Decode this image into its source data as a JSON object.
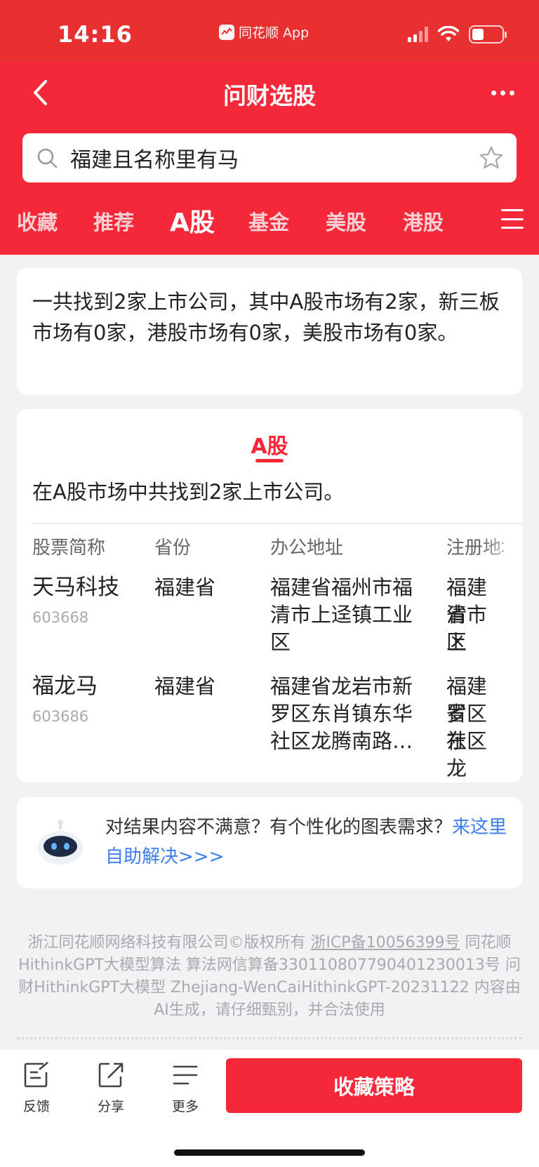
{
  "status": {
    "time": "14:16",
    "app": "同花顺 App"
  },
  "header": {
    "title": "问财选股"
  },
  "search": {
    "query": "福建且名称里有马"
  },
  "tabs": [
    "收藏",
    "推荐",
    "A股",
    "基金",
    "美股",
    "港股"
  ],
  "summary": {
    "text": "一共找到2家上市公司，其中A股市场有2家，新三板市场有0家，港股市场有0家，美股市场有0家。"
  },
  "results": {
    "market": "A股",
    "count_text": "在A股市场中共找到2家上市公司。",
    "columns": [
      "股票简称",
      "省份",
      "办公地址",
      "注册地址"
    ],
    "rows": [
      {
        "name": "天马科技",
        "code": "603668",
        "province": "福建省",
        "office": [
          "福建省福州市福",
          "清市上迳镇工业",
          "区"
        ],
        "reg": [
          "福建省",
          "清市上",
          "区"
        ]
      },
      {
        "name": "福龙马",
        "code": "603686",
        "province": "福建省",
        "office": [
          "福建省龙岩市新",
          "罗区东肖镇东华",
          "社区龙腾南路…"
        ],
        "reg": [
          "福建省",
          "罗区东",
          "社区龙"
        ]
      }
    ]
  },
  "help": {
    "text": "对结果内容不满意？有个性化的图表需求？",
    "link": "来这里自助解决>>>"
  },
  "footer": {
    "line1_a": "浙江同花顺网络科技有限公司©版权所有 ",
    "icp": "浙ICP备10056399号",
    "line1_b": " 同花顺HithinkGPT大模型算法 算法网信算备330110807790401230013号 问财HithinkGPT大模型 Zhejiang-WenCaiHithinkGPT-20231122 内容由AI生成，请仔细甄别，并合法使用"
  },
  "bottom": {
    "feedback": "反馈",
    "share": "分享",
    "more": "更多",
    "primary": "收藏策略"
  },
  "colors": {
    "brand": "#f5283a",
    "link": "#3a7ef1"
  }
}
